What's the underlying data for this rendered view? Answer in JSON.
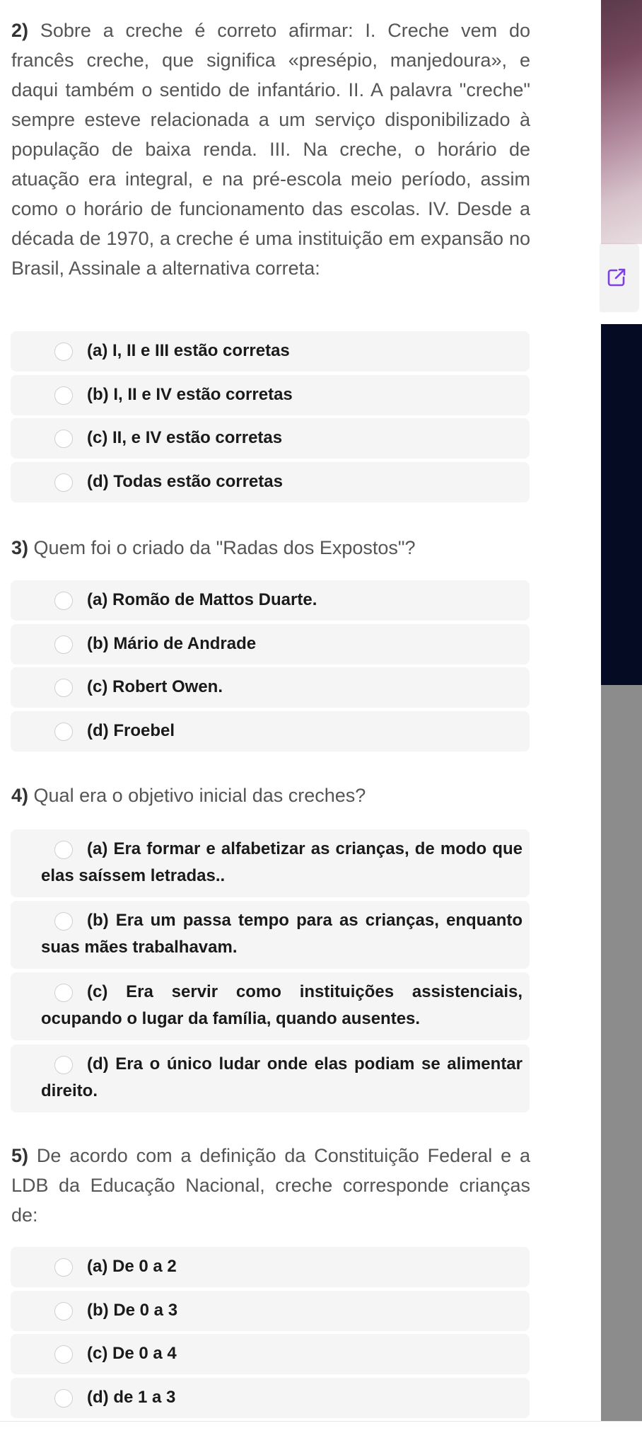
{
  "questions": [
    {
      "number": "2)",
      "text": "Sobre a creche é correto afirmar: I. Creche vem do francês creche, que significa «presépio, manjedoura», e daqui também o sentido de infantário. II. A palavra \"creche\" sempre esteve relacionada a um serviço disponibilizado à população de baixa renda. III. Na creche, o horário de atuação era integral, e na pré-escola meio período, assim como o horário de funcionamento das escolas. IV. Desde a década de 1970, a creche é uma instituição em expansão no Brasil, Assinale a alternativa correta:",
      "options": [
        "(a) I, II e III estão corretas",
        "(b) I, II e IV estão corretas",
        "(c) II, e IV estão corretas",
        "(d) Todas estão corretas"
      ]
    },
    {
      "number": "3)",
      "text": "Quem foi o criado da \"Radas dos Expostos\"?",
      "options": [
        "(a) Romão de Mattos Duarte.",
        "(b) Mário de Andrade",
        "(c) Robert Owen.",
        "(d) Froebel"
      ]
    },
    {
      "number": "4)",
      "text": "Qual era o objetivo inicial das creches?",
      "options": [
        "(a) Era formar e alfabetizar as crianças, de modo que elas saíssem letradas..",
        "(b) Era um passa tempo para as crianças, enquanto suas mães trabalhavam.",
        "(c) Era servir como instituições assistenciais, ocupando o lugar da família, quando ausentes.",
        "(d) Era o único ludar onde elas podiam se alimentar direito."
      ]
    },
    {
      "number": "5)",
      "text": "De acordo com a definição da Constituição Federal e a LDB da Educação Nacional, creche corresponde crianças de:",
      "options": [
        "(a) De 0 a 2",
        "(b) De 0 a 3",
        "(c) De 0 a 4",
        "(d) de 1 a 3"
      ]
    }
  ],
  "side_panel": {
    "open_icon": "external-link-icon",
    "accent_color": "#7b3fe4"
  },
  "colors": {
    "option_background": "#f5f5f5",
    "question_text": "#555555",
    "option_text": "#1a1a1a"
  }
}
